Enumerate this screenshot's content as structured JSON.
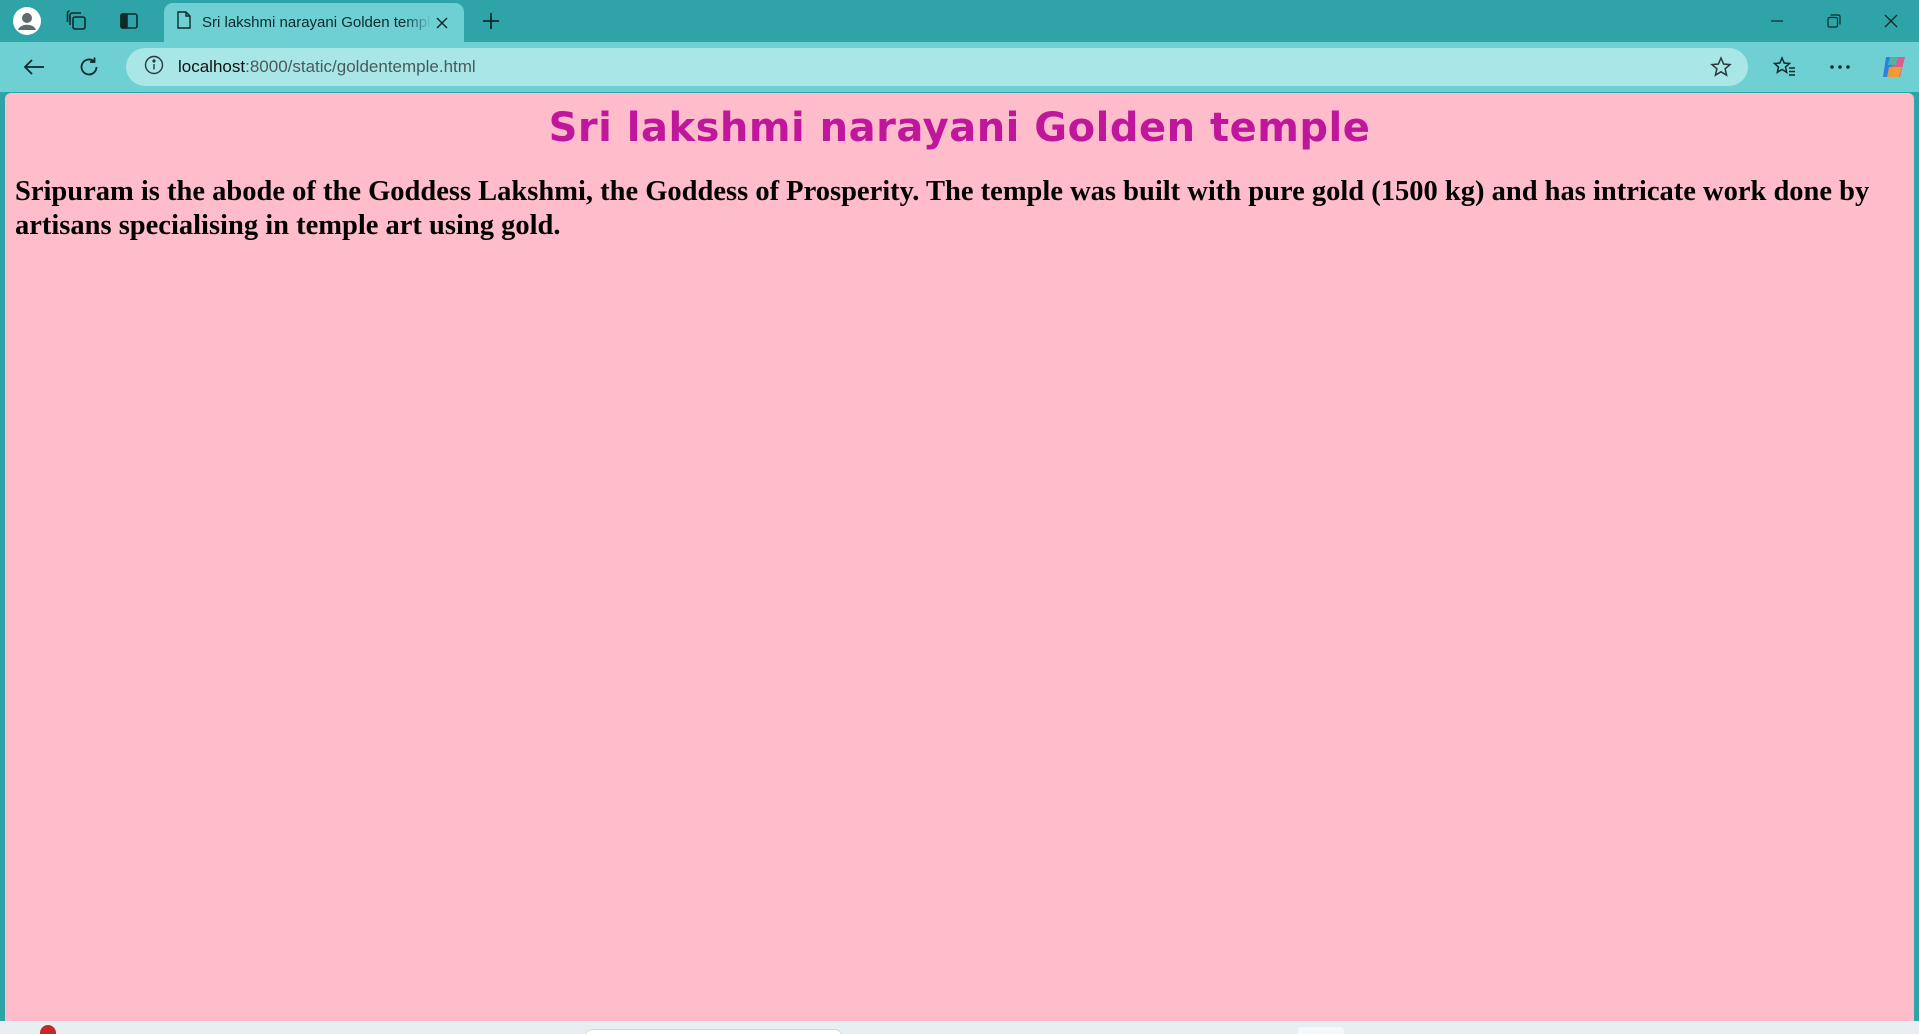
{
  "browser": {
    "tab": {
      "title": "Sri lakshmi narayani Golden temple"
    },
    "address": {
      "host": "localhost",
      "path": ":8000/static/goldentemple.html"
    },
    "colors": {
      "frame": "#2ea4a8",
      "toolbar": "#6fd0d3",
      "address_bar": "#a9e6e8"
    },
    "icons": {
      "profile": "profile-icon",
      "workspaces": "workspaces-icon",
      "tab_actions": "tab-actions-icon",
      "page": "page-icon",
      "close_tab": "close-icon",
      "new_tab": "plus-icon",
      "minimize": "minimize-icon",
      "restore": "restore-icon",
      "close_window": "close-icon",
      "back": "back-arrow-icon",
      "refresh": "refresh-icon",
      "info": "info-icon",
      "favorite": "star-icon",
      "favorites": "favorites-icon",
      "more": "more-icon",
      "copilot": "copilot-icon"
    }
  },
  "page": {
    "heading": "Sri lakshmi narayani Golden temple",
    "paragraph": "Sripuram is the abode of the Goddess Lakshmi, the Goddess of Prosperity. The temple was built with pure gold (1500 kg) and has intricate work done by artisans specialising in temple art using gold.",
    "colors": {
      "background": "#ffbccb",
      "heading": "#c0169c",
      "text": "#000000"
    }
  }
}
